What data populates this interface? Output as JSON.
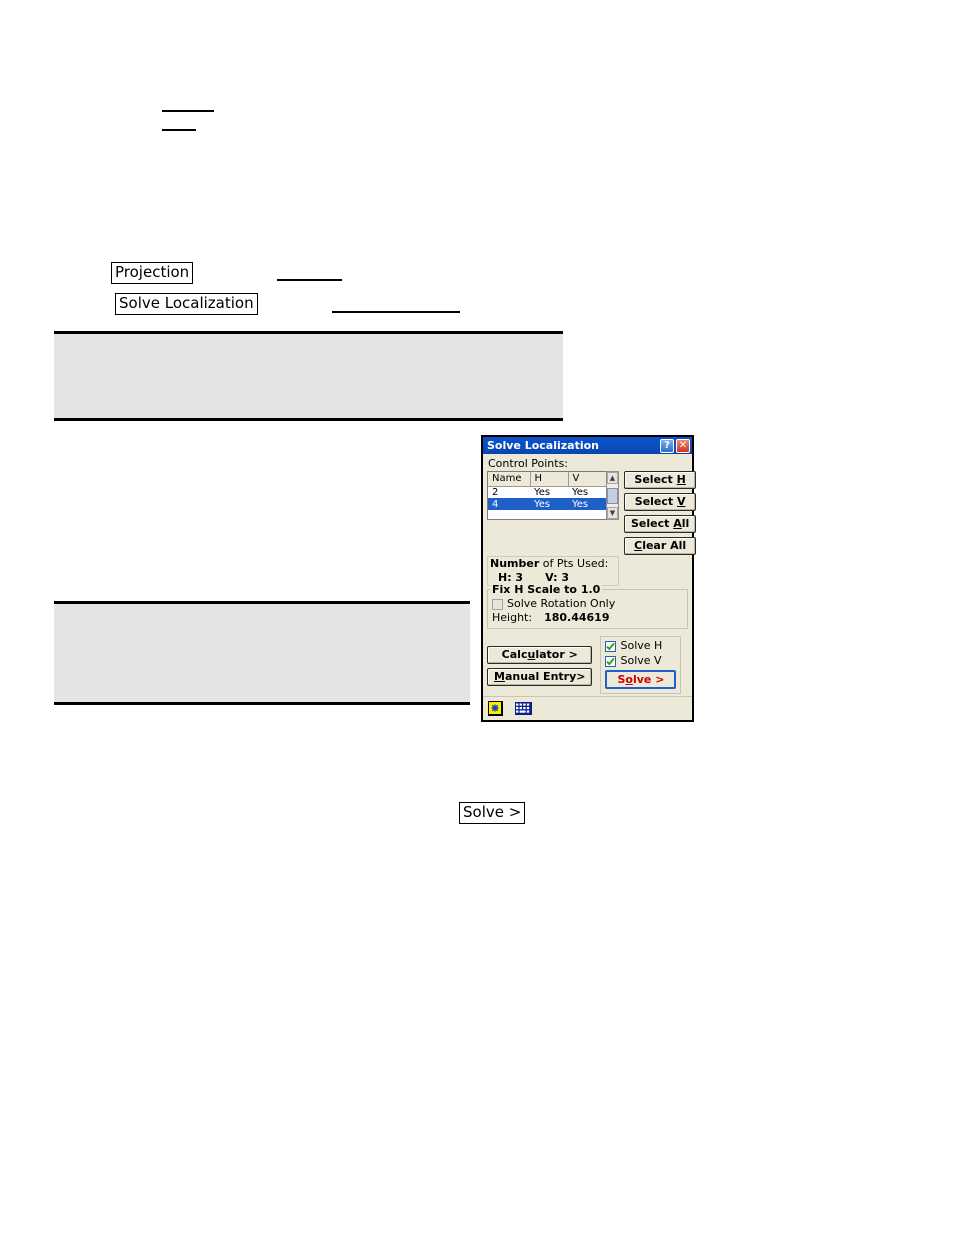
{
  "document": {
    "rules": [
      {
        "name": "top-rule-1"
      },
      {
        "name": "top-rule-2"
      },
      {
        "name": "projection-rule"
      },
      {
        "name": "solve-localization-rule"
      }
    ],
    "boxed_labels": {
      "projection": "Projection",
      "solve_localization": "Solve Localization",
      "solve_button_ref": "Solve >"
    },
    "gray_blocks": [
      {
        "name": "note-block-upper",
        "text": ""
      },
      {
        "name": "note-block-lower",
        "text": ""
      }
    ]
  },
  "dialog": {
    "title": "Solve Localization",
    "titlebar": {
      "help_label": "?",
      "close_label": "✕"
    },
    "control_points": {
      "label": "Control Points:",
      "columns": [
        "Name",
        "H",
        "V"
      ],
      "rows": [
        {
          "name": "2",
          "h": "Yes",
          "v": "Yes",
          "selected": false
        },
        {
          "name": "4",
          "h": "Yes",
          "v": "Yes",
          "selected": true
        }
      ],
      "scrollbar": {
        "up_arrow": "▲",
        "down_arrow": "▼"
      }
    },
    "select_buttons": {
      "select_h": {
        "pre": "Select ",
        "accel": "H",
        "post": ""
      },
      "select_v": {
        "pre": "Select ",
        "accel": "V",
        "post": ""
      },
      "select_all": {
        "pre": "Select ",
        "accel": "A",
        "post": "ll"
      },
      "clear_all": {
        "pre": "",
        "accel": "C",
        "post": "lear All"
      }
    },
    "points_used": {
      "title_bold": "Number",
      "title_rest": " of Pts Used:",
      "h_label": "H: 3",
      "v_label": "V: 3"
    },
    "fix_h_scale": {
      "legend": "Fix H Scale to 1.0",
      "solve_rotation_only": {
        "label": "Solve Rotation Only",
        "checked": false
      },
      "height_label": "Height:",
      "height_value": "180.44619"
    },
    "actions": {
      "calculator": {
        "pre": "Calc",
        "accel": "u",
        "post": "lator >"
      },
      "manual_entry": {
        "pre": "",
        "accel": "M",
        "post": "anual Entry>"
      },
      "solve_h": {
        "label": "Solve H",
        "checked": true
      },
      "solve_v": {
        "label": "Solve V",
        "checked": true
      },
      "solve_button": {
        "pre": "S",
        "accel": "o",
        "post": "lve >"
      }
    },
    "statusbar": {
      "icons": [
        "input-panel-icon",
        "keyboard-icon"
      ]
    },
    "colors": {
      "titlebar_blue": "#0a4ec0",
      "dialog_face": "#ece9d8",
      "selection_blue": "#1e5fc8",
      "solve_red": "#cc0000",
      "check_green": "#2ea02e",
      "close_red": "#cc3322"
    }
  }
}
